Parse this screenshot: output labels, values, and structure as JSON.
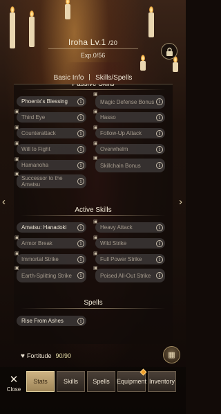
{
  "header": {
    "name": "Iroha Lv.1",
    "level_max": "/20",
    "exp": "Exp.0/56"
  },
  "tabs": {
    "basic_info": "Basic Info",
    "skills_spells": "Skills/Spells"
  },
  "passive": {
    "title": "Passive Skills",
    "items": [
      {
        "label": "Phoenix's Blessing",
        "locked": false
      },
      {
        "label": "Magic Defense Bonus",
        "locked": true
      },
      {
        "label": "Third Eye",
        "locked": true
      },
      {
        "label": "Hasso",
        "locked": true
      },
      {
        "label": "Counterattack",
        "locked": true
      },
      {
        "label": "Follow-Up Attack",
        "locked": true
      },
      {
        "label": "Will to Fight",
        "locked": true
      },
      {
        "label": "Overwhelm",
        "locked": true
      },
      {
        "label": "Hamanoha",
        "locked": true
      },
      {
        "label": "Skillchain Bonus",
        "locked": true
      },
      {
        "label": "Successor to the Amatsu",
        "locked": true
      }
    ]
  },
  "active": {
    "title": "Active Skills",
    "items": [
      {
        "label": "Amatsu: Hanadoki",
        "locked": false
      },
      {
        "label": "Heavy Attack",
        "locked": true
      },
      {
        "label": "Armor Break",
        "locked": true
      },
      {
        "label": "Wild Strike",
        "locked": true
      },
      {
        "label": "Immortal Strike",
        "locked": true
      },
      {
        "label": "Full Power Strike",
        "locked": true
      },
      {
        "label": "Earth-Splitting Strike",
        "locked": true
      },
      {
        "label": "Poised All-Out Strike",
        "locked": true
      }
    ]
  },
  "spells": {
    "title": "Spells",
    "items": [
      {
        "label": "Rise From Ashes",
        "locked": false
      }
    ]
  },
  "fortitude": {
    "label": "Fortitude",
    "value": "90/90"
  },
  "bottom": {
    "close": "Close",
    "nav": [
      "Stats",
      "Skills",
      "Spells",
      "Equipment",
      "Inventory"
    ],
    "active_index": 0
  },
  "icons": {
    "info": "info-icon",
    "lock": "lock-icon",
    "heart": "heart-icon",
    "book": "book-icon",
    "close": "close-icon"
  },
  "colors": {
    "active_tab": "#cdb383",
    "fortitude_value": "#e8dfa8"
  }
}
